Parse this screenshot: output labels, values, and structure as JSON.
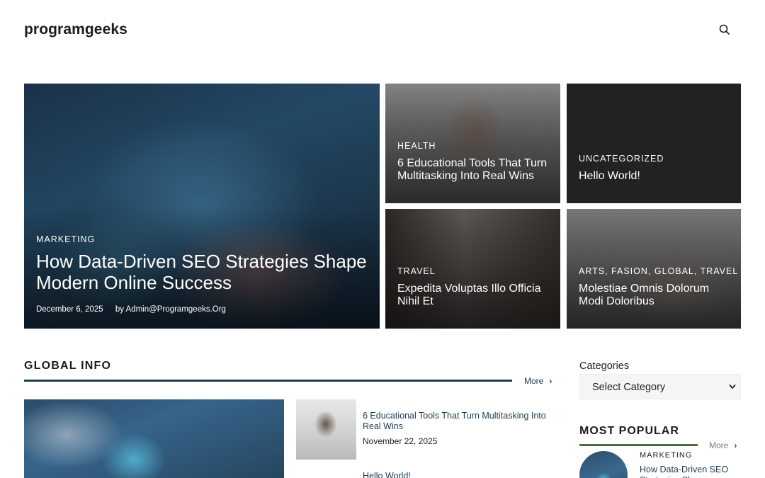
{
  "header": {
    "site_title": "programgeeks",
    "search_icon": "search-icon"
  },
  "featured": {
    "main": {
      "category": "MARKETING",
      "title": "How Data-Driven SEO Strategies Shape Modern Online Success",
      "date": "December 6, 2025",
      "author": "by Admin@Programgeeks.Org"
    },
    "tiles": [
      {
        "category": "HEALTH",
        "title": "6 Educational Tools That Turn Multitasking Into Real Wins"
      },
      {
        "category": "UNCATEGORIZED",
        "title": "Hello World!"
      },
      {
        "category": "TRAVEL",
        "title": "Expedita Voluptas Illo Officia Nihil Et"
      },
      {
        "category": "ARTS, FASION, GLOBAL, TRAVEL",
        "title": "Molestiae Omnis Dolorum Modi Doloribus"
      }
    ]
  },
  "global_info": {
    "title": "GLOBAL INFO",
    "more_label": "More",
    "posts": [
      {
        "title": "6 Educational Tools That Turn Multitasking Into Real Wins",
        "date": "November 22, 2025"
      },
      {
        "title": "Hello World!"
      }
    ]
  },
  "sidebar": {
    "categories_label": "Categories",
    "select_value": "Select Category",
    "most_popular": {
      "title": "MOST POPULAR",
      "more_label": "More",
      "category": "MARKETING",
      "post_title": "How Data-Driven SEO Strategies Shape Modern Online Success"
    }
  },
  "colors": {
    "accent_navy": "#1c3c52",
    "accent_green": "#4e6b3a",
    "dark_tile": "#222222"
  }
}
